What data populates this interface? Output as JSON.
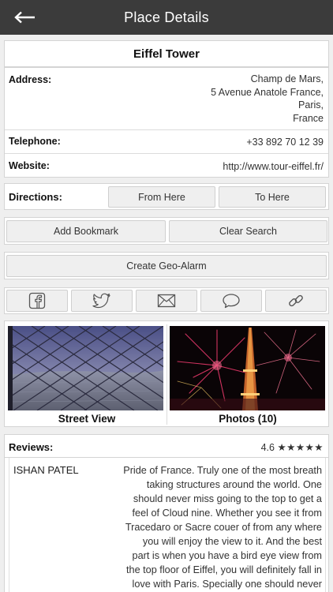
{
  "navbar": {
    "title": "Place Details",
    "back_icon": "arrow-left-icon"
  },
  "place": {
    "name": "Eiffel Tower"
  },
  "info": {
    "address_label": "Address:",
    "address_lines": [
      "Champ de Mars,",
      "5 Avenue Anatole France,",
      "Paris,",
      "France"
    ],
    "telephone_label": "Telephone:",
    "telephone_value": "+33 892 70 12 39",
    "website_label": "Website:",
    "website_value": "http://www.tour-eiffel.fr/"
  },
  "directions": {
    "label": "Directions:",
    "from_here": "From Here",
    "to_here": "To Here"
  },
  "actions": {
    "add_bookmark": "Add Bookmark",
    "clear_search": "Clear Search",
    "create_geo_alarm": "Create Geo-Alarm"
  },
  "share": [
    "facebook-icon",
    "twitter-icon",
    "mail-icon",
    "chat-bubble-icon",
    "link-icon"
  ],
  "media": {
    "street_view_label": "Street View",
    "photos_label": "Photos (10)"
  },
  "reviews": {
    "label": "Reviews:",
    "rating": "4.6",
    "stars": "★★★★★",
    "items": [
      {
        "author": "ISHAN PATEL",
        "text_lines": [
          "Pride of France. Truly one of the most breath",
          "taking structures around the world. One",
          "should never miss going to the top to get a",
          "feel of Cloud nine. Whether you see it from",
          "Tracedaro or Sacre couer of from any where",
          "you will enjoy the view to it. And the best",
          "part is when you have a bird eye view from",
          "the top floor of Eiffel, you will definitely fall in",
          "love with Paris. Specially one should never"
        ]
      }
    ]
  },
  "colors": {
    "navbar": "#3b3b3b",
    "card_border": "#d4d4d4",
    "button_bg": "#efefef",
    "page_bg": "#efefef"
  }
}
